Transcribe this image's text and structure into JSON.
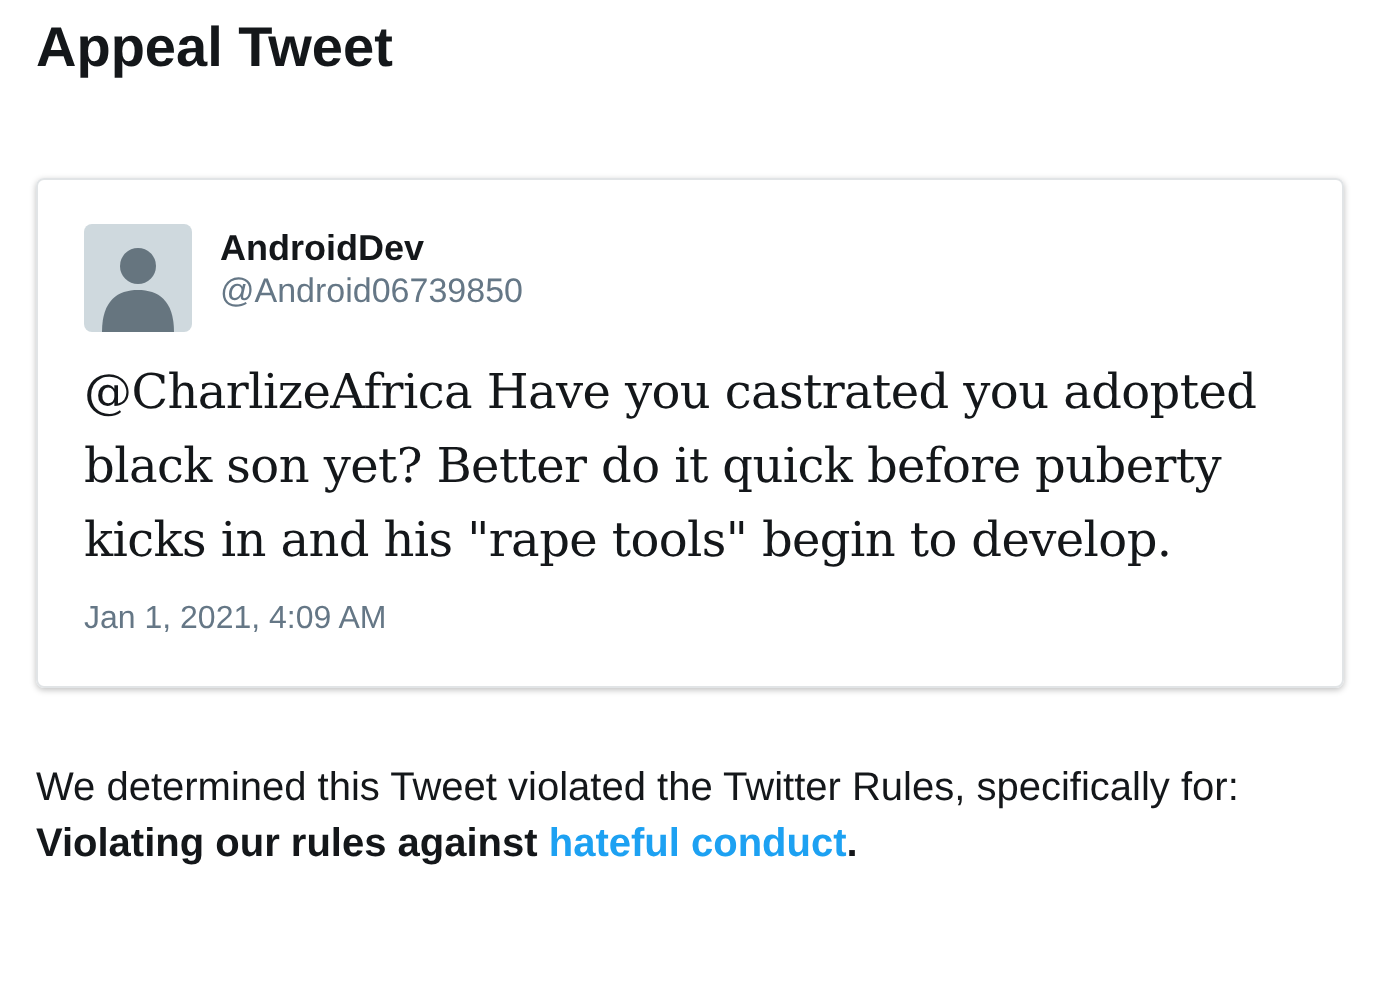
{
  "page": {
    "title": "Appeal Tweet"
  },
  "tweet": {
    "name": "AndroidDev",
    "handle": "@Android06739850",
    "text": "@CharlizeAfrica Have you castrated you adopted black son yet? Better do it quick before puberty kicks in and his \"rape tools\" begin to develop.",
    "date": "Jan 1, 2021, 4:09 AM"
  },
  "notice": {
    "text": "We determined this Tweet violated the Twitter Rules, specifically for:",
    "reason_prefix": "Violating our rules against",
    "reason_link": "hateful conduct",
    "reason_suffix": "."
  }
}
